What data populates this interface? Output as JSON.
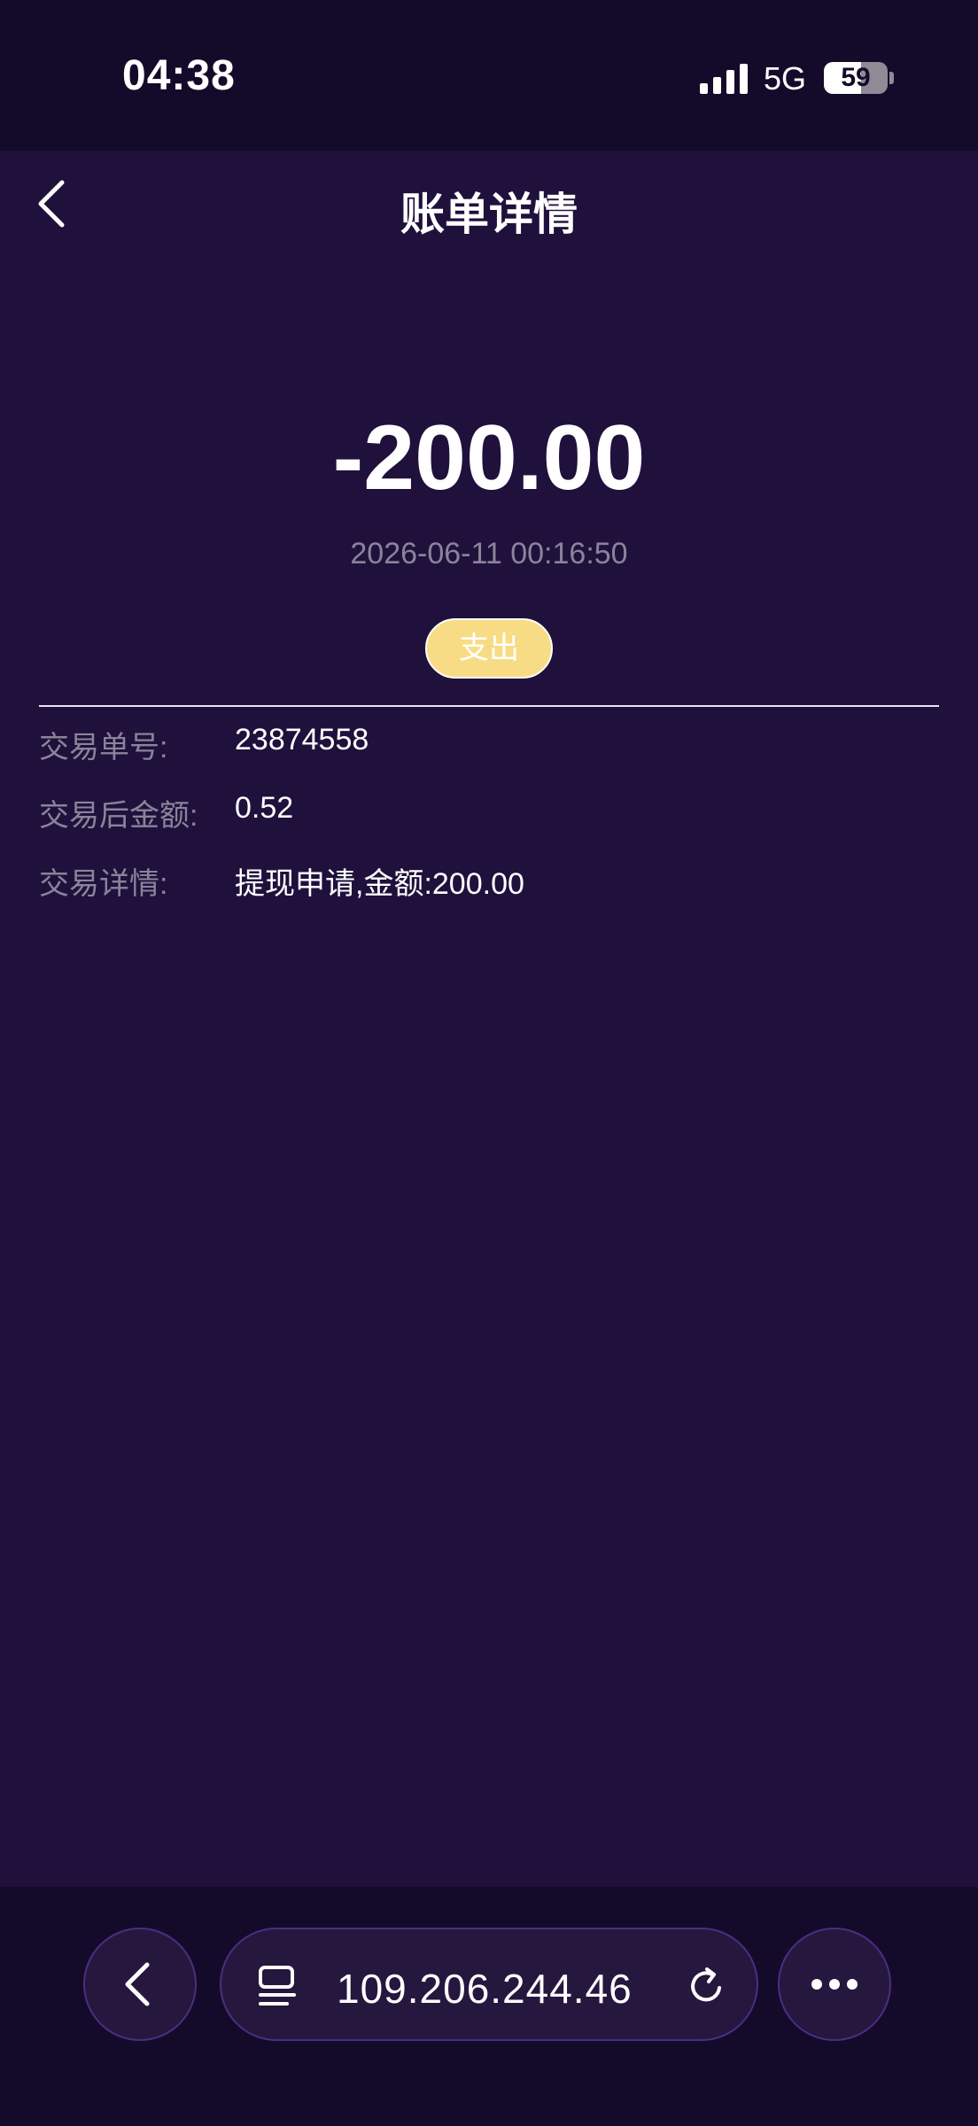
{
  "status_bar": {
    "time": "04:38",
    "network": "5G",
    "battery": "59",
    "battery_level": 0.59,
    "signal_icon": "signal-bars-icon"
  },
  "nav": {
    "title": "账单详情",
    "back_icon": "chevron-left-icon"
  },
  "transaction": {
    "amount": "-200.00",
    "datetime": "2026-06-11 00:16:50",
    "type_label": "支出",
    "details": [
      {
        "label": "交易单号:",
        "value": "23874558"
      },
      {
        "label": "交易后金额:",
        "value": "0.52"
      },
      {
        "label": "交易详情:",
        "value": "提现申请,金额:200.00"
      }
    ]
  },
  "browser": {
    "address": "109.206.244.46",
    "back_icon": "chevron-left-icon",
    "tabs_icon": "tabs-list-icon",
    "reload_icon": "reload-icon",
    "more_icon": "more-dots-icon"
  },
  "colors": {
    "background": "#1f113c",
    "status_background": "#140b2a",
    "badge": "#f7dc85",
    "muted_text": "#8a849a",
    "button_border": "#4b2e82"
  }
}
